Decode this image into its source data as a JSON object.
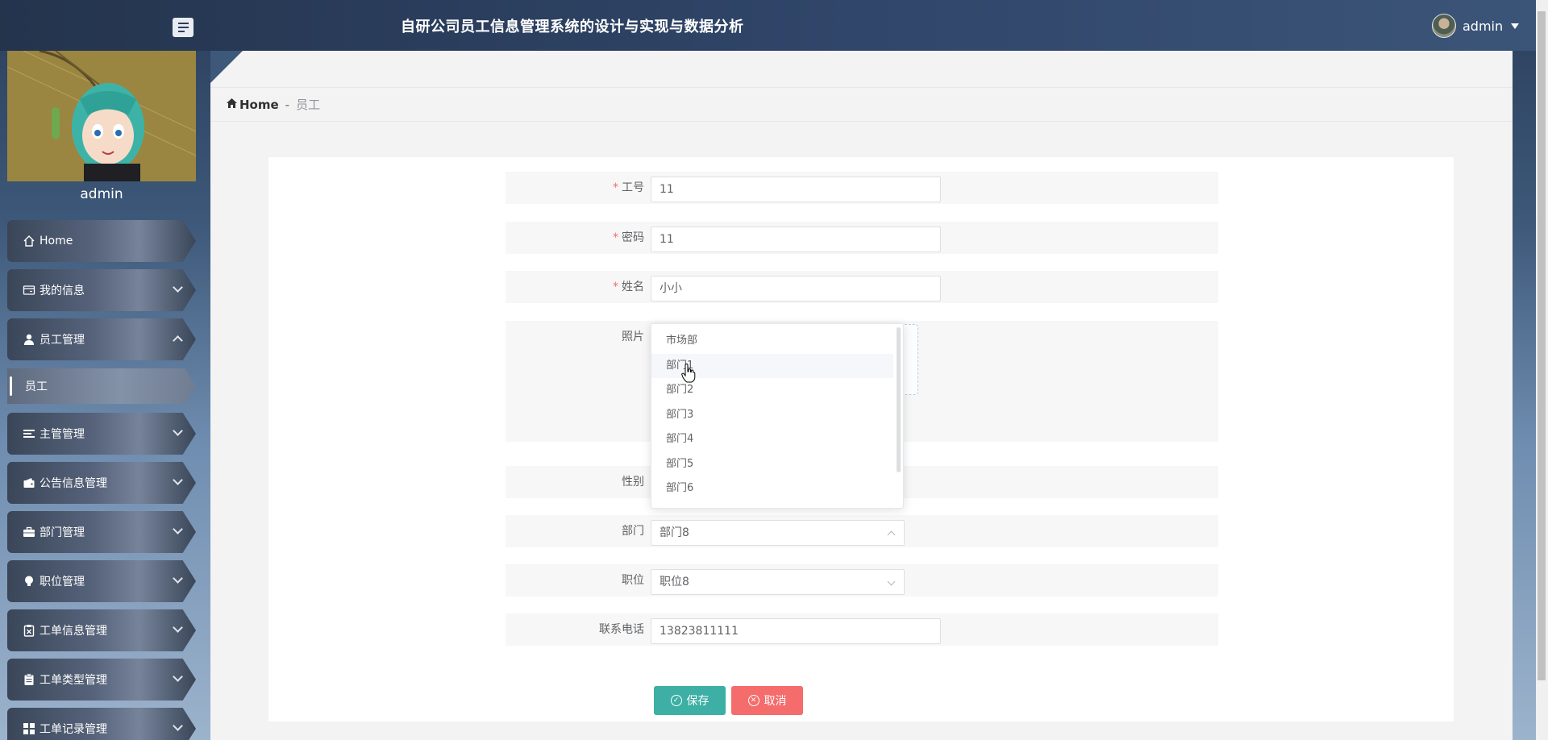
{
  "header": {
    "title": "自研公司员工信息管理系统的设计与实现与数据分析",
    "username": "admin"
  },
  "sidebar": {
    "username": "admin",
    "items": [
      {
        "label": "Home",
        "icon": "home-icon"
      },
      {
        "label": "我的信息",
        "icon": "id-card-icon"
      },
      {
        "label": "员工管理",
        "icon": "user-icon",
        "expanded": true,
        "children": [
          {
            "label": "员工"
          }
        ]
      },
      {
        "label": "主管管理",
        "icon": "list-icon"
      },
      {
        "label": "公告信息管理",
        "icon": "wallet-icon"
      },
      {
        "label": "部门管理",
        "icon": "briefcase-icon"
      },
      {
        "label": "职位管理",
        "icon": "bulb-icon"
      },
      {
        "label": "工单信息管理",
        "icon": "clipboard-x-icon"
      },
      {
        "label": "工单类型管理",
        "icon": "clipboard-icon"
      },
      {
        "label": "工单记录管理",
        "icon": "grid-icon"
      }
    ]
  },
  "breadcrumb": {
    "home": "Home",
    "separator": "-",
    "current": "员工"
  },
  "form": {
    "employee_no": {
      "label": "工号",
      "value": "11",
      "required": true
    },
    "password": {
      "label": "密码",
      "value": "11",
      "required": true
    },
    "name": {
      "label": "姓名",
      "value": "小小",
      "required": true
    },
    "photo": {
      "label": "照片"
    },
    "gender": {
      "label": "性别"
    },
    "department": {
      "label": "部门",
      "value": "部门8"
    },
    "position": {
      "label": "职位",
      "value": "职位8"
    },
    "phone": {
      "label": "联系电话",
      "value": "13823811111"
    }
  },
  "department_dropdown": {
    "options": [
      "市场部",
      "部门1",
      "部门2",
      "部门3",
      "部门4",
      "部门5",
      "部门6"
    ],
    "hovered_index": 1
  },
  "buttons": {
    "save": "保存",
    "cancel": "取消"
  },
  "colors": {
    "header_bg": "#30466a",
    "save_button": "#3dafa4",
    "cancel_button": "#f56c6c",
    "required_mark": "#f56c6c"
  }
}
